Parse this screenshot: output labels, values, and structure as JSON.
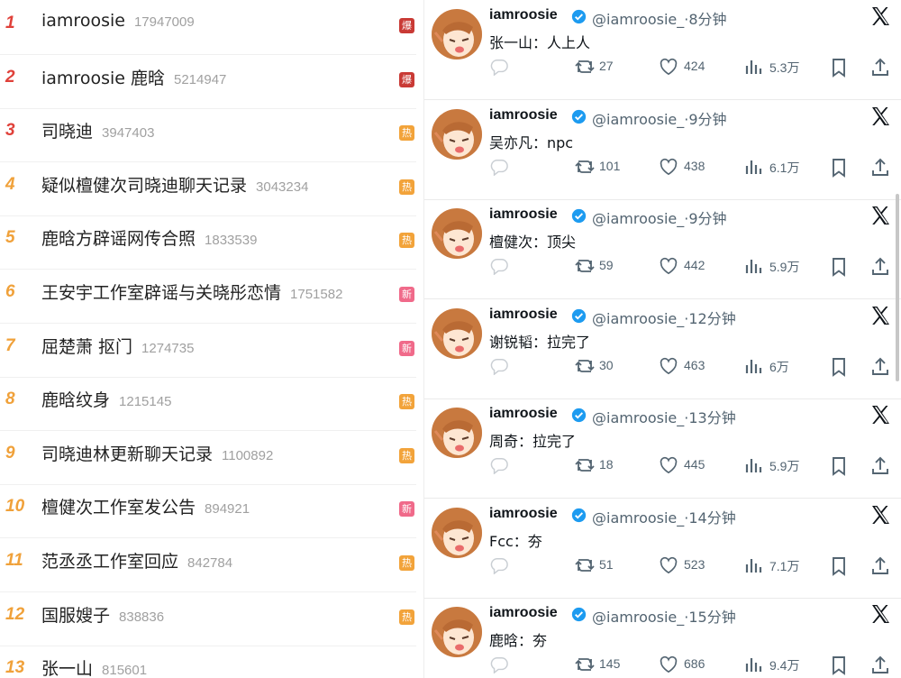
{
  "trending": {
    "items": [
      {
        "rank": "1",
        "title": "iamroosie",
        "count": "17947009",
        "badge": "爆",
        "rank_color": "#e0413a",
        "badge_color": "#c93a35"
      },
      {
        "rank": "2",
        "title": "iamroosie 鹿晗",
        "count": "5214947",
        "badge": "爆",
        "rank_color": "#e0413a",
        "badge_color": "#c93a35"
      },
      {
        "rank": "3",
        "title": "司晓迪",
        "count": "3947403",
        "badge": "热",
        "rank_color": "#e0413a",
        "badge_color": "#f2a33a"
      },
      {
        "rank": "4",
        "title": "疑似檀健次司晓迪聊天记录",
        "count": "3043234",
        "badge": "热",
        "rank_color": "#f0a13a",
        "badge_color": "#f2a33a"
      },
      {
        "rank": "5",
        "title": "鹿晗方辟谣网传合照",
        "count": "1833539",
        "badge": "热",
        "rank_color": "#f0a13a",
        "badge_color": "#f2a33a"
      },
      {
        "rank": "6",
        "title": "王安宇工作室辟谣与关晓彤恋情",
        "count": "1751582",
        "badge": "新",
        "rank_color": "#f0a13a",
        "badge_color": "#f06a8a"
      },
      {
        "rank": "7",
        "title": "屈楚萧 抠门",
        "count": "1274735",
        "badge": "新",
        "rank_color": "#f0a13a",
        "badge_color": "#f06a8a"
      },
      {
        "rank": "8",
        "title": "鹿晗纹身",
        "count": "1215145",
        "badge": "热",
        "rank_color": "#f0a13a",
        "badge_color": "#f2a33a"
      },
      {
        "rank": "9",
        "title": "司晓迪林更新聊天记录",
        "count": "1100892",
        "badge": "热",
        "rank_color": "#f0a13a",
        "badge_color": "#f2a33a"
      },
      {
        "rank": "10",
        "title": "檀健次工作室发公告",
        "count": "894921",
        "badge": "新",
        "rank_color": "#f0a13a",
        "badge_color": "#f06a8a"
      },
      {
        "rank": "11",
        "title": "范丞丞工作室回应",
        "count": "842784",
        "badge": "热",
        "rank_color": "#f0a13a",
        "badge_color": "#f2a33a"
      },
      {
        "rank": "12",
        "title": "国服嫂子",
        "count": "838836",
        "badge": "热",
        "rank_color": "#f0a13a",
        "badge_color": "#f2a33a"
      },
      {
        "rank": "13",
        "title": "张一山",
        "count": "815601",
        "badge": "",
        "rank_color": "#f0a13a",
        "badge_color": "#ffffff"
      }
    ]
  },
  "feed": {
    "tweets": [
      {
        "name": "iamroosie",
        "handle": "@iamroosie_·8分钟",
        "text": "张一山：人上人",
        "retweets": "27",
        "likes": "424",
        "views": "5.3万"
      },
      {
        "name": "iamroosie",
        "handle": "@iamroosie_·9分钟",
        "text": "吴亦凡：npc",
        "retweets": "101",
        "likes": "438",
        "views": "6.1万"
      },
      {
        "name": "iamroosie",
        "handle": "@iamroosie_·9分钟",
        "text": "檀健次：顶尖",
        "retweets": "59",
        "likes": "442",
        "views": "5.9万"
      },
      {
        "name": "iamroosie",
        "handle": "@iamroosie_·12分钟",
        "text": "谢锐韬：拉完了",
        "retweets": "30",
        "likes": "463",
        "views": "6万"
      },
      {
        "name": "iamroosie",
        "handle": "@iamroosie_·13分钟",
        "text": "周奇：拉完了",
        "retweets": "18",
        "likes": "445",
        "views": "5.9万"
      },
      {
        "name": "iamroosie",
        "handle": "@iamroosie_·14分钟",
        "text": "Fcc：夯",
        "retweets": "51",
        "likes": "523",
        "views": "7.1万"
      },
      {
        "name": "iamroosie",
        "handle": "@iamroosie_·15分钟",
        "text": "鹿晗：夯",
        "retweets": "145",
        "likes": "686",
        "views": "9.4万"
      }
    ]
  },
  "icons": {
    "reply": "reply-icon",
    "retweet": "retweet-icon",
    "like": "heart-icon",
    "views": "views-icon",
    "bookmark": "bookmark-icon",
    "share": "share-icon",
    "verified": "verified-badge-icon",
    "x": "x-logo-icon"
  },
  "colors": {
    "verified": "#1d9bf0",
    "text": "#0f1419",
    "muted": "#536471",
    "count": "#a0a0a0"
  }
}
